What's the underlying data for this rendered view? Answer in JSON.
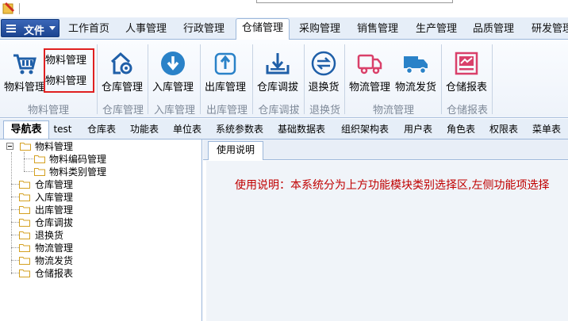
{
  "menubar": {
    "file_label": "文件",
    "tabs": [
      "工作首页",
      "人事管理",
      "行政管理",
      "仓储管理",
      "采购管理",
      "销售管理",
      "生产管理",
      "品质管理",
      "研发管理"
    ],
    "active_tab": "仓储管理"
  },
  "ribbon": {
    "material_btn": "物料管理",
    "material_sub": [
      "物料管理",
      "物料管理"
    ],
    "warehouse_btn": "仓库管理",
    "inbound_btn": "入库管理",
    "outbound_btn": "出库管理",
    "transfer_btn": "仓库调拔",
    "return_btn": "退换货",
    "logistics_btn": "物流管理",
    "delivery_btn": "物流发货",
    "report_btn": "仓储报表",
    "groups": [
      "物料管理",
      "仓库管理",
      "入库管理",
      "出库管理",
      "仓库调拔",
      "退换货",
      "物流管理",
      "仓储报表"
    ]
  },
  "navtabs": [
    "导航表",
    "test",
    "仓库表",
    "功能表",
    "单位表",
    "系统参数表",
    "基础数据表",
    "组织架构表",
    "用户表",
    "角色表",
    "权限表",
    "菜单表"
  ],
  "tree": {
    "root": "物料管理",
    "children": [
      "物料编码管理",
      "物料类别管理"
    ],
    "items": [
      "仓库管理",
      "入库管理",
      "出库管理",
      "仓库调拔",
      "退换货",
      "物流管理",
      "物流发货",
      "仓储报表"
    ]
  },
  "content": {
    "tab_label": "使用说明",
    "usage_text": "使用说明：本系统分为上方功能模块类别选择区,左侧功能项选择"
  },
  "colors": {
    "accent_blue": "#1c4490",
    "icon_blue": "#2a82c8",
    "icon_pink": "#d9406a",
    "usage_red": "#c00000",
    "highlight_red": "#e02020"
  }
}
